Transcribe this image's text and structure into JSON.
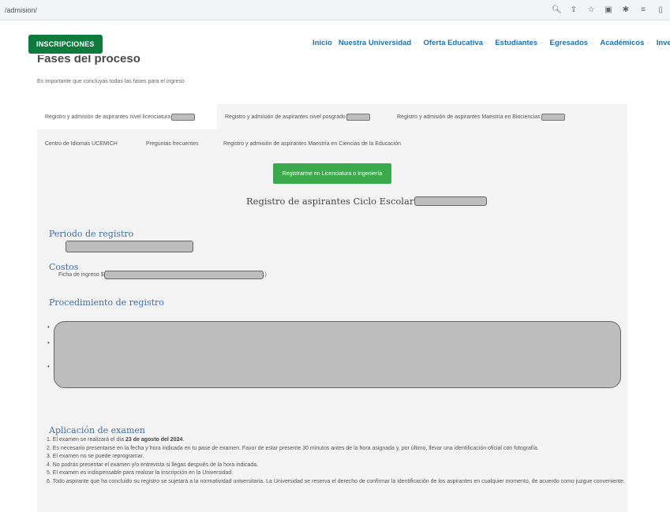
{
  "browser": {
    "url": "/admision/"
  },
  "header": {
    "inscripciones_label": "INSCRIPCIONES",
    "nav": [
      {
        "label": "Inicio",
        "dropdown": false
      },
      {
        "label": "Nuestra Universidad",
        "dropdown": true
      },
      {
        "label": "Oferta Educativa",
        "dropdown": true
      },
      {
        "label": "Estudiantes",
        "dropdown": true
      },
      {
        "label": "Egresados",
        "dropdown": true
      },
      {
        "label": "Académicos",
        "dropdown": true
      },
      {
        "label": "Investiga",
        "dropdown": false
      }
    ]
  },
  "page": {
    "title": "Fases del proceso",
    "subtitle": "Es importante que concluyas todas las fases para el ingreso"
  },
  "tabs": [
    {
      "label": "Registro y admisión de aspirantes nivel licenciatura",
      "active": true,
      "redacted": true
    },
    {
      "label": "Registro y admisión de aspirantes nivel posgrado",
      "active": false,
      "redacted": true
    },
    {
      "label": "Registro y admisión de aspirantes Maestría en Biociencias",
      "active": false,
      "redacted": true
    },
    {
      "label": "Centro de Idiomas UCEMICH",
      "active": false,
      "redacted": false
    },
    {
      "label": "Preguntas frecuentes",
      "active": false,
      "redacted": false
    },
    {
      "label": "Registro y admisión de aspirantes Maestría en Ciencias de la Educación",
      "active": false,
      "redacted": false
    }
  ],
  "panel": {
    "register_button": "Registrarme en Licenciatura o Ingeniería",
    "ciclo_title": "Registro de aspirantes Ciclo Escolar",
    "periodo_heading": "Periodo de registro",
    "costos_heading": "Costos",
    "ficha_prefix": "Ficha de ingreso $",
    "ficha_suffix": ".)",
    "procedimiento_heading": "Procedimiento de registro",
    "bullet_char": "•",
    "examen_heading": "Aplicación de examen",
    "exam_items": [
      {
        "num": "1.",
        "text": "El examen se realizará el día ",
        "bold": "23 de agosto del 2024",
        "after": "."
      },
      {
        "num": "2.",
        "text": "Es necesario presentarse en la fecha y hora indicada en tu pase de examen. Favor de estar presente 30 minutos antes de la hora asignada y, por último, llevar una identificación oficial con fotografía.",
        "bold": "",
        "after": ""
      },
      {
        "num": "3.",
        "text": "El examen  no se puede reprogramar.",
        "bold": "",
        "after": ""
      },
      {
        "num": "4.",
        "text": "No podrás presentar el examen y/o entrevista si llegas después de la hora indicada.",
        "bold": "",
        "after": ""
      },
      {
        "num": "5.",
        "text": "El examen es indispensable para realizar la inscripción en la Universidad.",
        "bold": "",
        "after": ""
      },
      {
        "num": "6.",
        "text": "Todo aspirante que ha concluido su registro se sujetará a la normatividad universitaria. La Universidad se reserva el derecho de confirmar la identificación de los aspirantes en cualquier momento, de acuerdo como juzgue conveniente.",
        "bold": "",
        "after": ""
      }
    ]
  },
  "icons": [
    "zoom-icon",
    "share-icon",
    "star-icon",
    "extension-icon",
    "puzzle-icon",
    "menu-icon",
    "sidebar-icon"
  ]
}
